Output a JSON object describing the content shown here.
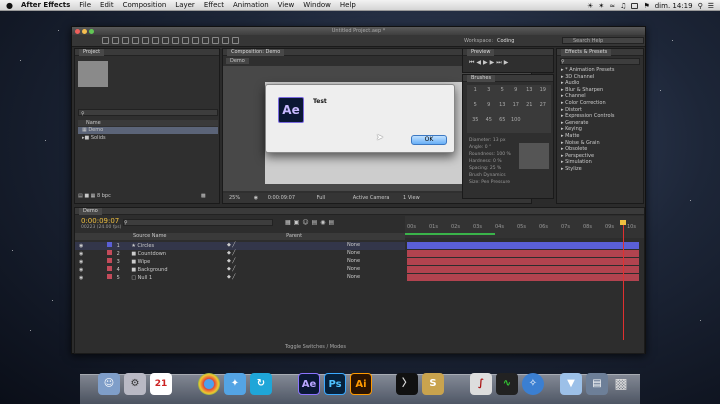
{
  "menubar": {
    "apple": "",
    "app_name": "After Effects",
    "items": [
      "File",
      "Edit",
      "Composition",
      "Layer",
      "Effect",
      "Animation",
      "View",
      "Window",
      "Help"
    ],
    "clock": "dim. 14:19"
  },
  "window": {
    "title": "Untitled Project.aep *"
  },
  "toolbar": {
    "workspace_label": "Workspace:",
    "workspace_value": "Coding",
    "search_placeholder": "Search Help"
  },
  "project": {
    "tab": "Project",
    "search_placeholder": "",
    "column_name": "Name",
    "items": [
      "Demo",
      "Solids"
    ],
    "bpc": "8 bpc"
  },
  "composition": {
    "tab": "Composition: Demo",
    "crumb": "Demo",
    "zoom": "25%",
    "timecode": "0:00:09:07",
    "resolution": "Full",
    "camera": "Active Camera",
    "views": "1 View"
  },
  "dialog": {
    "logo": "Ae",
    "title": "Test",
    "ok_label": "OK"
  },
  "preview": {
    "tab": "Preview"
  },
  "brushes": {
    "tab": "Brushes",
    "sizes": [
      "1",
      "3",
      "5",
      "9",
      "13",
      "19",
      "5",
      "9",
      "13",
      "17",
      "21",
      "27",
      "35",
      "45",
      "65",
      "100"
    ],
    "diameter": "Diameter: 13 px",
    "angle": "Angle: 0 °",
    "roundness": "Roundness: 100 %",
    "hardness": "Hardness: 0 %",
    "spacing": "Spacing: 25 %",
    "dynamics": "Brush Dynamics",
    "size_label": "Size:",
    "size_value": "Pen Pressure"
  },
  "effects": {
    "tab": "Effects & Presets",
    "items": [
      "* Animation Presets",
      "3D Channel",
      "Audio",
      "Blur & Sharpen",
      "Channel",
      "Color Correction",
      "Distort",
      "Expression Controls",
      "Generate",
      "Keying",
      "Matte",
      "Noise & Grain",
      "Obsolete",
      "Perspective",
      "Simulation",
      "Stylize"
    ]
  },
  "timeline": {
    "tab": "Demo",
    "timecode": "0:00:09:07",
    "frames": "00223 (24.00 fps)",
    "col_source": "Source Name",
    "col_parent": "Parent",
    "ruler": [
      "00s",
      "01s",
      "02s",
      "03s",
      "04s",
      "05s",
      "06s",
      "07s",
      "08s",
      "09s",
      "10s"
    ],
    "layers": [
      {
        "num": "1",
        "name": "Circles",
        "parent": "None",
        "color": "#5a5fd6"
      },
      {
        "num": "2",
        "name": "Countdown",
        "parent": "None",
        "color": "#c34b5a"
      },
      {
        "num": "3",
        "name": "Wipe",
        "parent": "None",
        "color": "#c34b5a"
      },
      {
        "num": "4",
        "name": "Background",
        "parent": "None",
        "color": "#c34b5a"
      },
      {
        "num": "5",
        "name": "Null 1",
        "parent": "None",
        "color": "#c34b5a"
      }
    ],
    "toggle_label": "Toggle Switches / Modes"
  },
  "dock": {
    "calendar_day": "21",
    "apps": [
      "Ae",
      "Ps",
      "Ai"
    ]
  }
}
